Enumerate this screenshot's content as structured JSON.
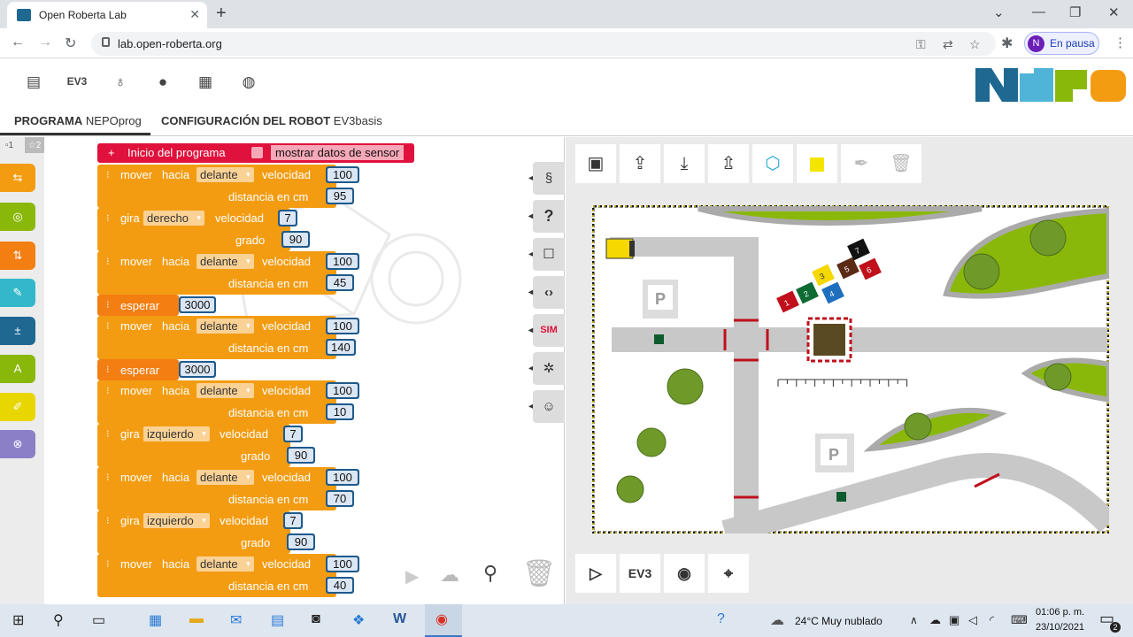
{
  "browser": {
    "tab_title": "Open Roberta Lab",
    "url": "lab.open-roberta.org",
    "profile_initial": "N",
    "profile_status": "En pausa"
  },
  "toolbar": {
    "ev3_label": "EV3"
  },
  "tabs": {
    "program_label": "PROGRAMA",
    "program_name": "NEPOprog",
    "config_label": "CONFIGURACIÓN DEL ROBOT",
    "config_name": "EV3basis"
  },
  "workspace": {
    "counter_left": "1",
    "counter_right": "2",
    "start_label": "Inicio del programa",
    "sensor_label": "mostrar datos de sensor",
    "blocks": [
      {
        "kind": "move",
        "label1": "mover",
        "label2": "hacia",
        "dir": "delante",
        "speed_label": "velocidad",
        "speed": "100",
        "param_label": "distancia en cm",
        "param": "95"
      },
      {
        "kind": "turn",
        "label1": "gira",
        "dir": "derecho",
        "speed_label": "velocidad",
        "speed": "7",
        "param_label": "grado",
        "param": "90"
      },
      {
        "kind": "move",
        "label1": "mover",
        "label2": "hacia",
        "dir": "delante",
        "speed_label": "velocidad",
        "speed": "100",
        "param_label": "distancia en cm",
        "param": "45"
      },
      {
        "kind": "wait",
        "label1": "esperar",
        "value": "3000"
      },
      {
        "kind": "move",
        "label1": "mover",
        "label2": "hacia",
        "dir": "delante",
        "speed_label": "velocidad",
        "speed": "100",
        "param_label": "distancia en cm",
        "param": "140"
      },
      {
        "kind": "wait",
        "label1": "esperar",
        "value": "3000"
      },
      {
        "kind": "move",
        "label1": "mover",
        "label2": "hacia",
        "dir": "delante",
        "speed_label": "velocidad",
        "speed": "100",
        "param_label": "distancia en cm",
        "param": "10"
      },
      {
        "kind": "turn",
        "label1": "gira",
        "dir": "izquierdo",
        "speed_label": "velocidad",
        "speed": "7",
        "param_label": "grado",
        "param": "90"
      },
      {
        "kind": "move",
        "label1": "mover",
        "label2": "hacia",
        "dir": "delante",
        "speed_label": "velocidad",
        "speed": "100",
        "param_label": "distancia en cm",
        "param": "70"
      },
      {
        "kind": "turn",
        "label1": "gira",
        "dir": "izquierdo",
        "speed_label": "velocidad",
        "speed": "7",
        "param_label": "grado",
        "param": "90"
      },
      {
        "kind": "move",
        "label1": "mover",
        "label2": "hacia",
        "dir": "delante",
        "speed_label": "velocidad",
        "speed": "100",
        "param_label": "distancia en cm",
        "param": "40"
      }
    ]
  },
  "side_buttons": {
    "sim_label": "SIM"
  },
  "simulator": {
    "ev3_button_label": "EV3",
    "parking_label": "P",
    "numbered_tiles": [
      "1",
      "2",
      "3",
      "4",
      "5",
      "6",
      "7"
    ],
    "tile_colors": [
      "#c0101c",
      "#0e6b32",
      "#f4d800",
      "#1f6fbf",
      "#5a2a14",
      "#c0101c",
      "#111111"
    ]
  },
  "taskbar": {
    "weather": "24°C  Muy nublado",
    "time": "01:06 p. m.",
    "date": "23/10/2021",
    "notifications": "2"
  }
}
